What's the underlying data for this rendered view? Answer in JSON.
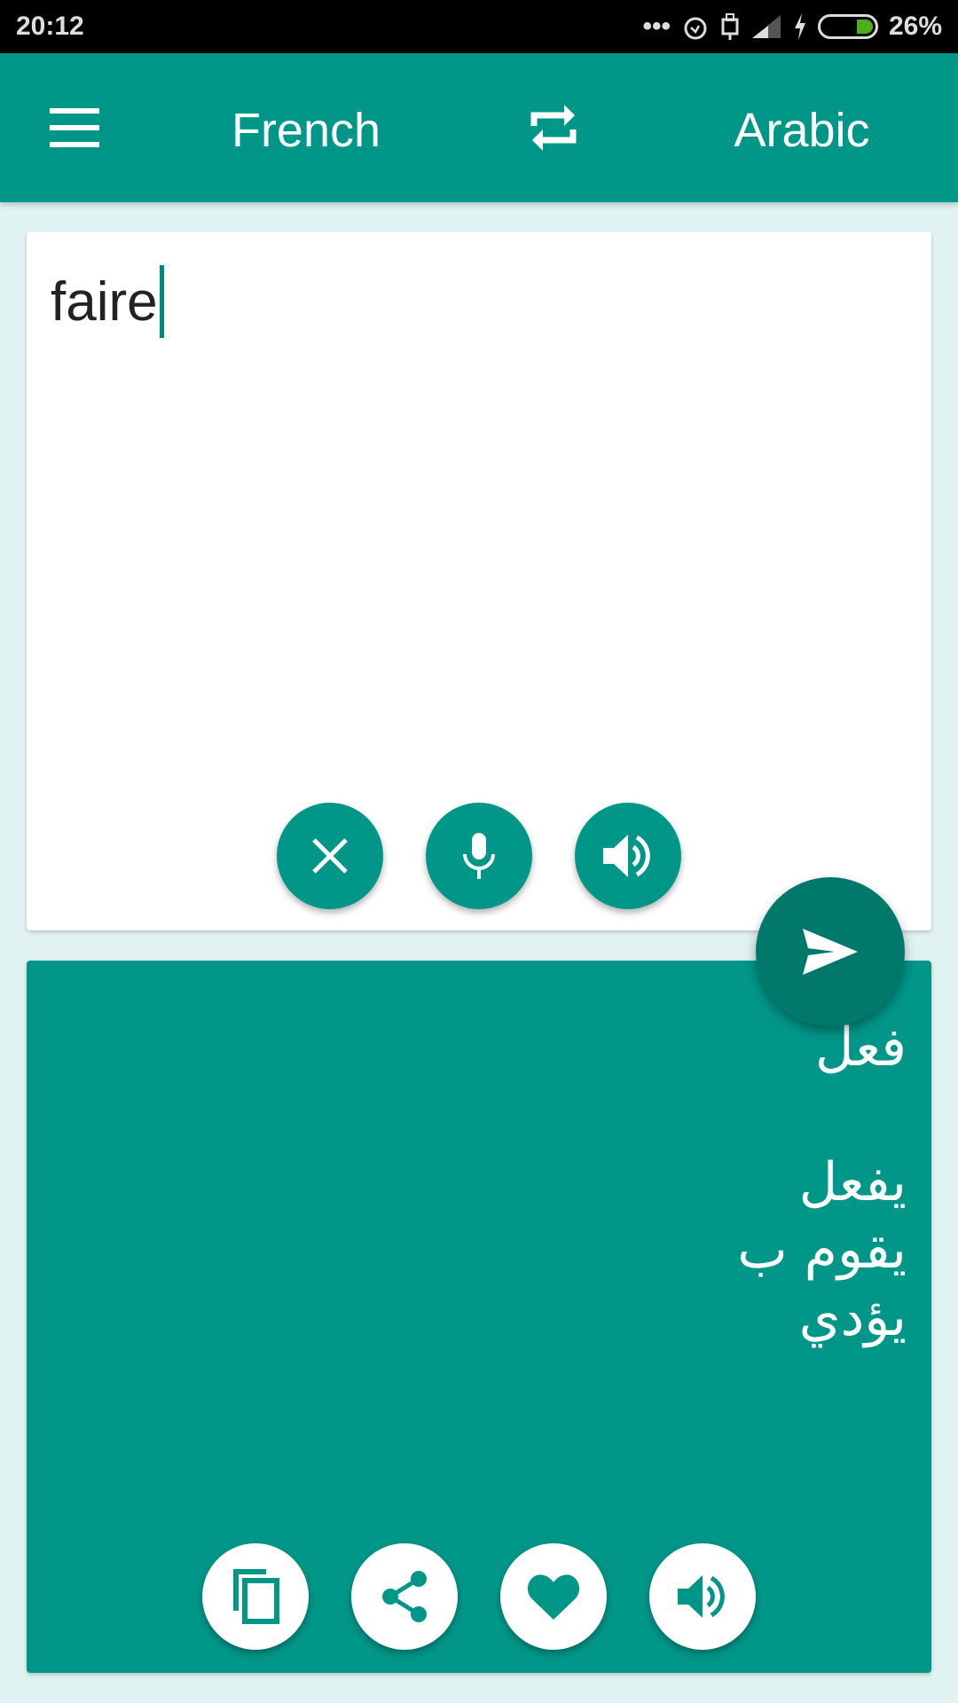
{
  "status_bar": {
    "time": "20:12",
    "battery": "26%",
    "battery_level": 0.26,
    "icons": [
      "more-dots-icon",
      "alarm-icon",
      "usb-icon",
      "signal-icon",
      "charging-icon",
      "battery-icon"
    ]
  },
  "toolbar": {
    "source_language": "French",
    "target_language": "Arabic",
    "icons": [
      "menu-icon",
      "swap-icon"
    ]
  },
  "input": {
    "value": "faire",
    "buttons": [
      "clear-icon",
      "microphone-icon",
      "speaker-icon"
    ]
  },
  "translate_button": {
    "icon": "send-icon"
  },
  "output": {
    "lines": [
      "فعل",
      "",
      "يفعل",
      "يقوم ب",
      "يؤدي"
    ],
    "buttons": [
      "copy-icon",
      "share-icon",
      "favorite-icon",
      "speaker-icon"
    ]
  },
  "colors": {
    "primary": "#009688",
    "primary_dark": "#00796b",
    "background": "#e0f2f1"
  }
}
